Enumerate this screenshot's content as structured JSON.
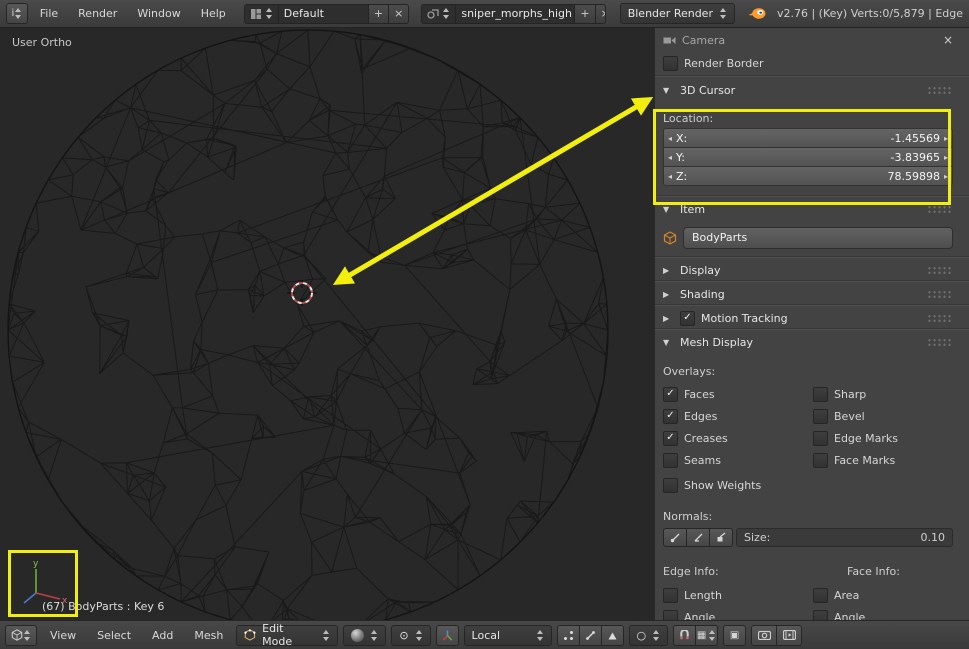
{
  "colors": {
    "highlight": "#f2ef0c",
    "header_bg": "#3f3f3f",
    "panel_bg": "#434343",
    "viewport_bg": "#282828",
    "logo_orange": "#ff9c2a"
  },
  "icons": {
    "check": "✓",
    "plus": "+",
    "close": "×",
    "tri_down": "▼",
    "tri_right": "▶",
    "step_left": "◂",
    "step_right": "▸",
    "pivot": "⊙",
    "prop_circle": "○",
    "grid": "▦",
    "occlude": "▣",
    "rotate": "↻",
    "scale": "□",
    "translate": "+",
    "info": "i"
  },
  "top_header": {
    "menus": [
      {
        "label": "File"
      },
      {
        "label": "Render"
      },
      {
        "label": "Window"
      },
      {
        "label": "Help"
      }
    ],
    "screen_layout": {
      "value": "Default"
    },
    "scene": {
      "value": "sniper_morphs_high"
    },
    "render_engine": {
      "value": "Blender Render"
    },
    "stats": "v2.76 | (Key) Verts:0/5,879 | Edge"
  },
  "viewport": {
    "view_label": "User Ortho",
    "object_info": "(67) BodyParts : Key 6"
  },
  "sidebar": {
    "camera": {
      "title": "Camera"
    },
    "render_border": {
      "label": "Render Border",
      "checked": false
    },
    "cursor": {
      "title": "3D Cursor",
      "location_label": "Location:",
      "fields": [
        {
          "label": "X:",
          "value": "-1.45569"
        },
        {
          "label": "Y:",
          "value": "-3.83965"
        },
        {
          "label": "Z:",
          "value": "78.59898"
        }
      ]
    },
    "item": {
      "title": "Item",
      "name": "BodyParts"
    },
    "display": {
      "title": "Display"
    },
    "shading": {
      "title": "Shading"
    },
    "motion_tracking": {
      "title": "Motion Tracking",
      "checked": true
    },
    "mesh_display": {
      "title": "Mesh Display",
      "overlays_label": "Overlays:",
      "left_checks": [
        {
          "label": "Faces",
          "checked": true
        },
        {
          "label": "Edges",
          "checked": true
        },
        {
          "label": "Creases",
          "checked": true
        },
        {
          "label": "Seams",
          "checked": false
        },
        {
          "label": "Show Weights",
          "checked": false
        }
      ],
      "right_checks": [
        {
          "label": "Sharp",
          "checked": false
        },
        {
          "label": "Bevel",
          "checked": false
        },
        {
          "label": "Edge Marks",
          "checked": false
        },
        {
          "label": "Face Marks",
          "checked": false
        }
      ],
      "normals_label": "Normals:",
      "size_label": "Size:",
      "size_value": "0.10",
      "edge_info_label": "Edge Info:",
      "face_info_label": "Face Info:",
      "edge_checks": [
        {
          "label": "Length",
          "checked": false
        },
        {
          "label": "Angle",
          "checked": false
        }
      ],
      "face_checks": [
        {
          "label": "Area",
          "checked": false
        },
        {
          "label": "Angle",
          "checked": false
        }
      ]
    }
  },
  "bottom_header": {
    "menus": [
      {
        "label": "View"
      },
      {
        "label": "Select"
      },
      {
        "label": "Add"
      },
      {
        "label": "Mesh"
      }
    ],
    "mode": {
      "value": "Edit Mode"
    },
    "orientation": {
      "value": "Local"
    }
  }
}
